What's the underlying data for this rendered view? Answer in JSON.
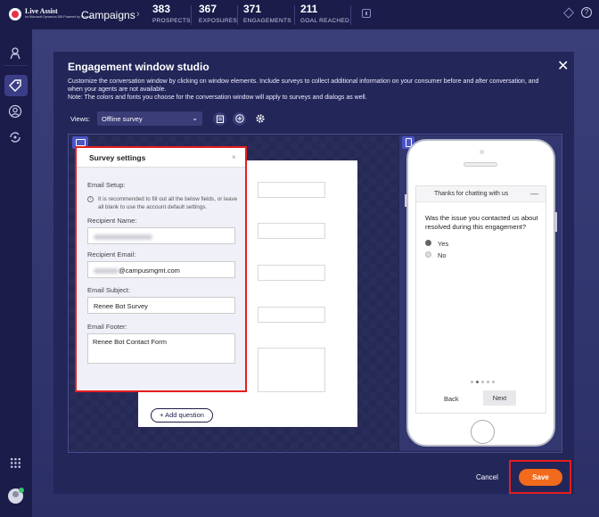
{
  "topbar": {
    "logo_name": "Live Assist",
    "logo_tagline": "for Microsoft Dynamics 365 Powered by Nuance",
    "app_title": "Campaigns",
    "metrics": [
      {
        "value": "383",
        "label": "PROSPECTS"
      },
      {
        "value": "367",
        "label": "EXPOSURES"
      },
      {
        "value": "371",
        "label": "ENGAGEMENTS"
      },
      {
        "value": "211",
        "label": "GOAL REACHED"
      }
    ],
    "help_glyph": "?"
  },
  "modal": {
    "title": "Engagement window studio",
    "description": "Customize the conversation window by clicking on window elements. Include surveys to collect additional information on your consumer before and after conversation, and when your agents are not available.",
    "note": "Note: The colors and fonts you choose for the conversation window will apply to surveys and dialogs as well.",
    "views_label": "Views:",
    "views_value": "Offline survey",
    "add_question": "+ Add question",
    "cancel": "Cancel",
    "save": "Save"
  },
  "settings": {
    "title": "Survey settings",
    "close": "×",
    "email_setup": "Email Setup:",
    "note": "It is recommended to fill out all the below fields, or leave all blank to use the account default settings.",
    "recipient_name_label": "Recipient Name:",
    "recipient_email_label": "Recipient Email:",
    "recipient_email_value": "@campusmgmt.com",
    "email_subject_label": "Email Subject:",
    "email_subject_value": "Renee Bot Survey",
    "email_footer_label": "Email Footer:",
    "email_footer_value": "Renee Bot Contact Form"
  },
  "phone": {
    "chat_title": "Thanks for chatting with us",
    "question": "Was the issue you contacted us about resolved during this engagement?",
    "options": [
      "Yes",
      "No"
    ],
    "selected_option": "Yes",
    "back": "Back",
    "next": "Next"
  },
  "icons": {
    "rail": [
      "agent-icon",
      "tag-icon",
      "user-icon",
      "sync-icon",
      "grid-icon",
      "avatar"
    ],
    "toolbar": [
      "clipboard-icon",
      "plus-circle-icon",
      "gear-icon"
    ]
  },
  "colors": {
    "save": "#f26a1b",
    "highlight": "#e41e1e",
    "topbar": "#1b1c4a"
  }
}
